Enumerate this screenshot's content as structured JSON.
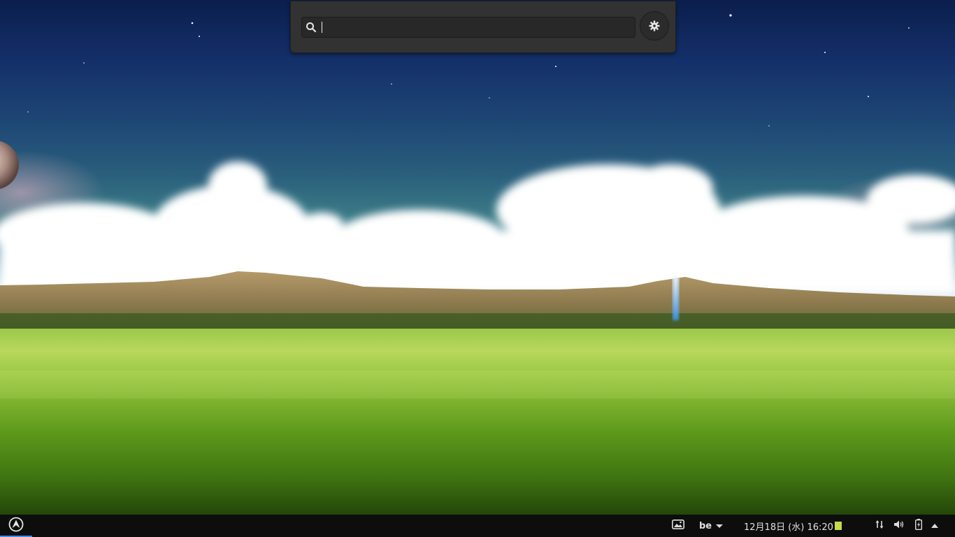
{
  "launcher": {
    "search_value": "",
    "search_icon": "search-icon",
    "settings_icon": "gear-icon"
  },
  "taskbar": {
    "start_icon": "arch-logo-icon",
    "show_desktop_icon": "show-desktop-icon",
    "keyboard_layout": "be",
    "clock": "12月18日 (水) 16:20",
    "network_icon": "network-arrows-icon",
    "volume_icon": "volume-icon",
    "battery_icon": "battery-charging-icon",
    "tray_icon": "chevron-up-icon"
  },
  "colors": {
    "panel_bg": "#323232",
    "taskbar_bg": "#0d0d0d",
    "accent": "#3d8ee8"
  }
}
